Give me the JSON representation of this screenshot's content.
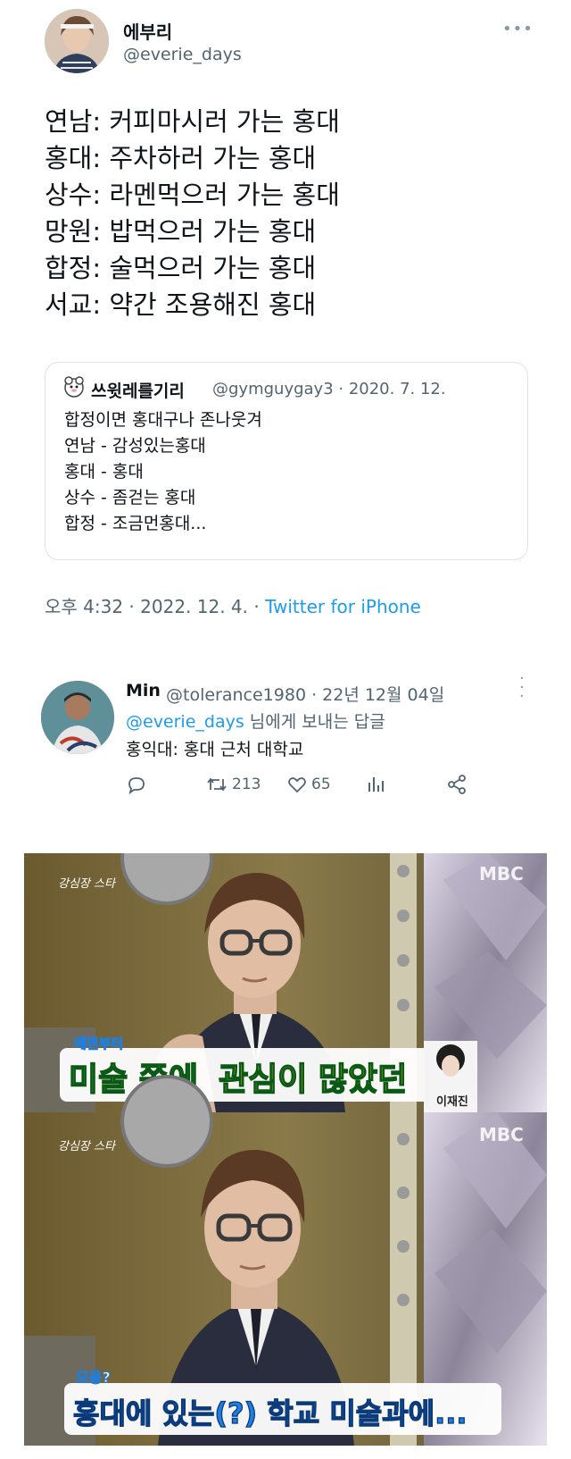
{
  "tweet": {
    "display_name": "에부리",
    "handle": "@everie_days",
    "more_icon": "more-horizontal-icon",
    "lines": [
      "연남: 커피마시러 가는 홍대",
      "홍대: 주차하러 가는 홍대",
      "상수: 라멘먹으러 가는 홍대",
      "망원: 밥먹으러 가는 홍대",
      "합정: 술먹으러 가는 홍대",
      "서교: 약간 조용해진 홍대"
    ],
    "quote": {
      "name": "쓰윗레를기리",
      "meta": "@gymguygay3 · 2020. 7. 12.",
      "lines": [
        "합정이면 홍대구나 존나웃겨",
        "연남 - 감성있는홍대",
        "홍대 - 홍대",
        "상수 - 좀걷는 홍대",
        "합정 - 조금먼홍대..."
      ]
    },
    "timestamp": "오후 4:32 · 2022. 12. 4. · ",
    "source": "Twitter for iPhone"
  },
  "reply": {
    "name": "Min",
    "meta": "@tolerance1980 · 22년 12월 04일",
    "reply_to_mention": "@everie_days",
    "reply_to_suffix": " 님에게 보내는 답글",
    "text": "홍익대: 홍대 근처 대학교",
    "retweets": "213",
    "likes": "65"
  },
  "image": {
    "panel1": {
      "small_caption": "예전부터",
      "caption_part1": "미술 쪽에 ",
      "caption_part2": "관심이 많았던",
      "name_tag": "이재진",
      "logo": "MBC"
    },
    "panel2": {
      "small_caption": "으응?",
      "caption": "홍대에 있는(?) 학교 미술과에...",
      "logo": "MBC"
    }
  },
  "colors": {
    "link": "#1d9bf0",
    "secondary_text": "#536471",
    "caption_green": "#2fbf3a",
    "caption_blue": "#1f7fe0"
  }
}
